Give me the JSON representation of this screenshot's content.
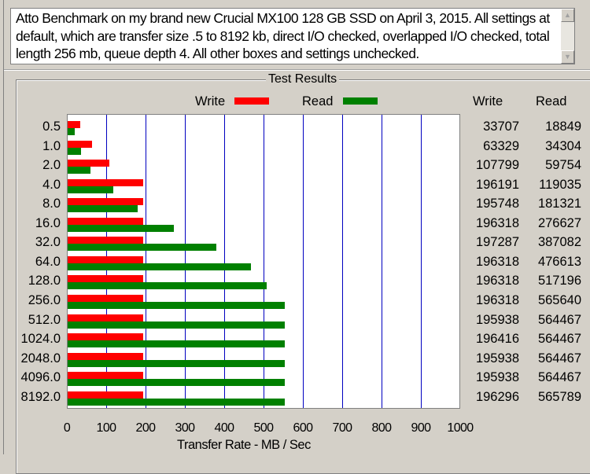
{
  "description": {
    "text": "Atto Benchmark on my brand new Crucial MX100 128 GB SSD on April 3, 2015. All settings at default, which are transfer size .5 to 8192 kb, direct I/O checked, overlapped I/O checked, total length 256 mb, queue depth 4. All other boxes and settings unchecked.",
    "scroll_up_icon": "triangle-up",
    "scroll_down_icon": "triangle-down"
  },
  "group_title": "Test Results",
  "table_headers": {
    "write": "Write",
    "read": "Read"
  },
  "colors": {
    "write": "#ff0000",
    "read": "#008000",
    "gridline": "#0000c0",
    "plot_bg": "#ffffff",
    "window_bg": "#d4d0c8"
  },
  "chart_data": {
    "type": "bar",
    "orientation": "horizontal",
    "title": "Test Results",
    "xlabel": "Transfer Rate - MB / Sec",
    "ylabel": "",
    "xlim": [
      0,
      1000
    ],
    "xticks": [
      "0",
      "100",
      "200",
      "300",
      "400",
      "500",
      "600",
      "700",
      "800",
      "900",
      "1000"
    ],
    "grid": true,
    "legend": {
      "placement": "top",
      "entries": [
        "Write",
        "Read"
      ]
    },
    "categories": [
      "0.5",
      "1.0",
      "2.0",
      "4.0",
      "8.0",
      "16.0",
      "32.0",
      "64.0",
      "128.0",
      "256.0",
      "512.0",
      "1024.0",
      "2048.0",
      "4096.0",
      "8192.0"
    ],
    "series": [
      {
        "name": "Write",
        "color": "#ff0000",
        "values_kbps": [
          33707,
          63329,
          107799,
          196191,
          195748,
          196318,
          197287,
          196318,
          196318,
          196318,
          195938,
          196416,
          195938,
          195938,
          196296
        ],
        "values": [
          32.9,
          61.8,
          105.3,
          191.6,
          191.2,
          191.7,
          192.7,
          191.7,
          191.7,
          191.7,
          191.3,
          191.8,
          191.3,
          191.3,
          191.7
        ]
      },
      {
        "name": "Read",
        "color": "#008000",
        "values_kbps": [
          18849,
          34304,
          59754,
          119035,
          181321,
          276627,
          387082,
          476613,
          517196,
          565640,
          564467,
          564467,
          564467,
          564467,
          565789
        ],
        "values": [
          18.4,
          33.5,
          58.4,
          116.2,
          177.1,
          270.1,
          378.0,
          465.4,
          505.1,
          552.4,
          551.2,
          551.2,
          551.2,
          551.2,
          552.5
        ]
      }
    ]
  }
}
